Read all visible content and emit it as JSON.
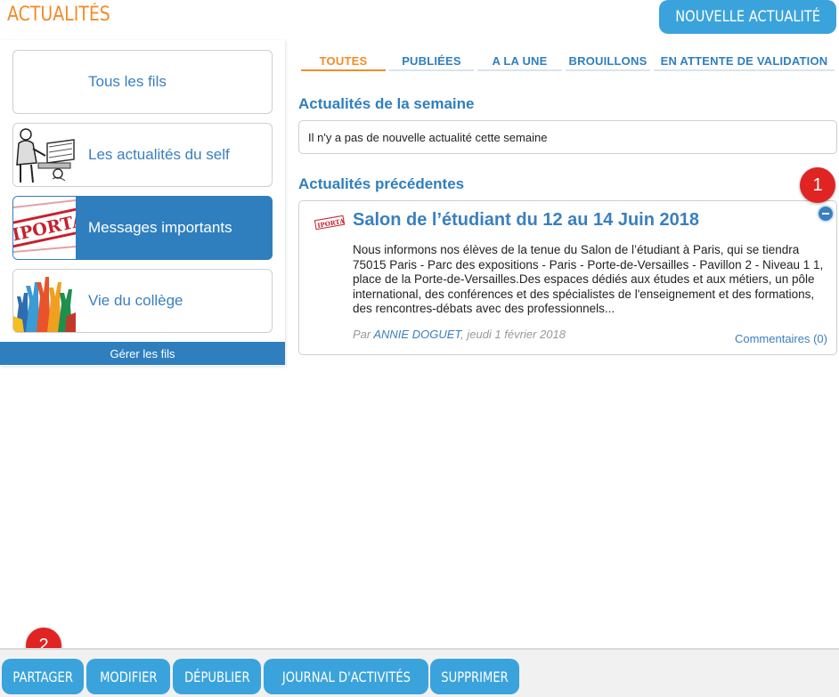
{
  "header": {
    "title": "ACTUALITÉS",
    "new_button": "NOUVELLE ACTUALITÉ"
  },
  "sidebar": {
    "feeds": [
      {
        "label": "Tous les fils",
        "icon": "none"
      },
      {
        "label": "Les actualités du self",
        "icon": "cafeteria-drawing-icon"
      },
      {
        "label": "Messages importants",
        "icon": "important-stamp-icon",
        "active": true
      },
      {
        "label": "Vie du collège",
        "icon": "raised-hands-icon"
      }
    ],
    "manage_label": "Gérer les fils"
  },
  "tabs": [
    {
      "label": "TOUTES",
      "active": true
    },
    {
      "label": "PUBLIÉES"
    },
    {
      "label": "A LA UNE"
    },
    {
      "label": "BROUILLONS"
    },
    {
      "label": "EN ATTENTE DE VALIDATION"
    }
  ],
  "week": {
    "heading": "Actualités de la semaine",
    "empty_text": "Il n'y a pas de nouvelle actualité cette semaine"
  },
  "previous": {
    "heading": "Actualités précédentes",
    "item": {
      "title": "Salon de l’étudiant du 12 au 14 Juin 2018",
      "body": "Nous informons nos élèves de la tenue du Salon de l’étudiant à Paris, qui se tiendra 75015 Paris - Parc des expositions - Paris - Porte-de-Versailles - Pavillon 2 - Niveau 1 1, place de la Porte-de-Versailles.Des espaces dédiés aux études et aux métiers, un pôle international, des conférences et des spécialistes de l'enseignement et des formations, des rencontres-débats avec des professionnels...",
      "meta_prefix": "Par ",
      "author": "ANNIE DOGUET",
      "date": ", jeudi 1 février 2018",
      "comments": "Commentaires (0)",
      "icon_text": "IPORTAN"
    }
  },
  "markers": [
    "1",
    "2"
  ],
  "actions": [
    "PARTAGER",
    "MODIFIER",
    "DÉPUBLIER",
    "JOURNAL D'ACTIVITÉS",
    "SUPPRIMER"
  ],
  "colors": {
    "accent_orange": "#f28c28",
    "primary_blue": "#2f7fbf",
    "button_blue": "#3ba3dc",
    "marker_red": "#e02424"
  }
}
